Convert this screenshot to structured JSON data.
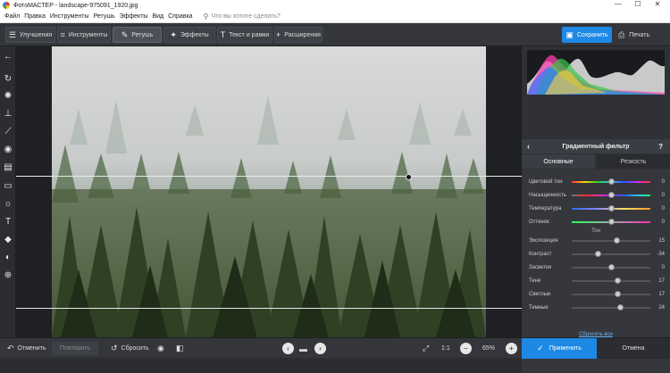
{
  "titlebar": {
    "title": "ФотоМАСТЕР - landscape-975091_1920.jpg",
    "minimize": "—",
    "maximize": "☐",
    "close": "✕"
  },
  "menu": {
    "items": [
      "Файл",
      "Правка",
      "Инструменты",
      "Ретушь",
      "Эффекты",
      "Вид",
      "Справка"
    ],
    "search_placeholder": "Что вы хотите сделать?"
  },
  "toolbar": {
    "tabs": [
      {
        "label": "Улучшения",
        "icon": "sliders-icon"
      },
      {
        "label": "Инструменты",
        "icon": "crop-icon"
      },
      {
        "label": "Ретушь",
        "icon": "brush-icon",
        "active": true
      },
      {
        "label": "Эффекты",
        "icon": "magic-wand-icon"
      },
      {
        "label": "Текст и рамки",
        "icon": "text-icon"
      },
      {
        "label": "Расширения",
        "icon": "plus-icon"
      }
    ],
    "save_label": "Сохранить",
    "print_label": "Печать"
  },
  "left_tools": [
    "back-arrow-icon",
    "rotate-icon",
    "stamp-patch-icon",
    "clone-stamp-icon",
    "brush-icon",
    "radial-filter-icon",
    "gradient-filter-icon",
    "vignette-icon",
    "light-icon",
    "text-tool-icon",
    "fill-bucket-icon",
    "red-eye-icon",
    "portrait-icon"
  ],
  "panel": {
    "title": "Градиентный фильтр",
    "help": "?",
    "tabs": [
      "Основные",
      "Резкость"
    ],
    "color_sliders": [
      {
        "label": "Цветовой тон",
        "value": "0",
        "pos": 0.5
      },
      {
        "label": "Насыщенность",
        "value": "0",
        "pos": 0.5
      },
      {
        "label": "Температура",
        "value": "0",
        "pos": 0.5
      },
      {
        "label": "Оттенок",
        "value": "0",
        "pos": 0.5
      }
    ],
    "tone_label": "Тон",
    "tone_sliders": [
      {
        "label": "Экспозиция",
        "value": "15",
        "pos": 0.57
      },
      {
        "label": "Контраст",
        "value": "-34",
        "pos": 0.33
      },
      {
        "label": "Засветки",
        "value": "0",
        "pos": 0.5
      },
      {
        "label": "Тени",
        "value": "17",
        "pos": 0.58
      },
      {
        "label": "Светлые",
        "value": "17",
        "pos": 0.58
      },
      {
        "label": "Темные",
        "value": "24",
        "pos": 0.62
      }
    ],
    "reset_all": "Сбросить все"
  },
  "bottom": {
    "undo": "Отменить",
    "redo": "Повторить",
    "reset": "Сбросить",
    "zoom_ratio": "1:1",
    "zoom": "65%",
    "apply": "Применить",
    "cancel": "Отмена"
  },
  "colors": {
    "accent": "#1e88e5",
    "panel": "#35373c",
    "toolbar": "#34363b"
  }
}
